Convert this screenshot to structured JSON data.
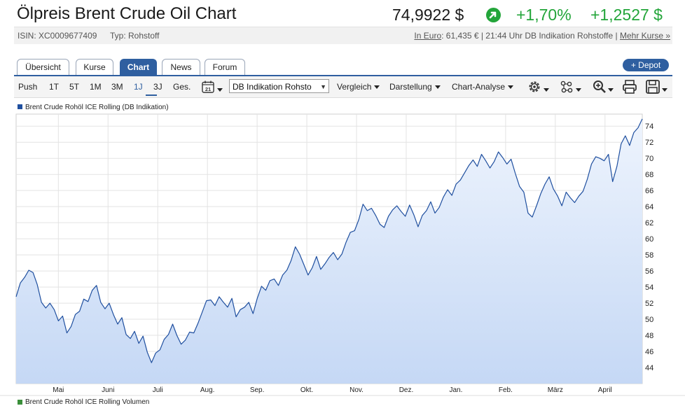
{
  "header": {
    "title": "Ölpreis Brent Crude Oil Chart",
    "price": "74,9922 $",
    "change_pct": "+1,70%",
    "change_abs": "+1,2527 $",
    "positive_color": "#23a53a",
    "trend_icon": "arrow-up-right-icon"
  },
  "subbar": {
    "isin": "ISIN: XC0009677409",
    "type": "Typ: Rohstoff",
    "in_euro_link": "In Euro",
    "euro_info": ": 61,435 € | 21:44 Uhr DB Indikation Rohstoffe | ",
    "more_link": "Mehr Kurse »"
  },
  "tabs": [
    {
      "label": "Übersicht",
      "active": false
    },
    {
      "label": "Kurse",
      "active": false
    },
    {
      "label": "Chart",
      "active": true
    },
    {
      "label": "News",
      "active": false
    },
    {
      "label": "Forum",
      "active": false
    }
  ],
  "depot_button": "+ Depot",
  "toolbar": {
    "periods": [
      "Push",
      "1T",
      "5T",
      "1M",
      "3M",
      "1J",
      "3J",
      "Ges."
    ],
    "active_period": "1J",
    "calendar_icon_day": "21",
    "source_select": "DB Indikation Rohsto",
    "menus": [
      "Vergleich",
      "Darstellung",
      "Chart-Analyse"
    ],
    "icons": [
      "gear-icon",
      "network-icon",
      "zoom-in-icon",
      "print-icon",
      "save-icon"
    ]
  },
  "chart_legend": "Brent Crude Rohöl ICE Rolling (DB Indikation)",
  "volume_legend": "Brent Crude Rohöl ICE Rolling Volumen",
  "accent_color": "#2f5fa0",
  "chart_data": {
    "type": "area",
    "title": "",
    "xlabel": "",
    "ylabel": "",
    "ylim": [
      42,
      75.5
    ],
    "y_ticks": [
      44,
      46,
      48,
      50,
      52,
      54,
      56,
      58,
      60,
      62,
      64,
      66,
      68,
      70,
      72,
      74
    ],
    "y_tick_labels": [
      "44",
      "46",
      "48",
      "50",
      "52",
      "54",
      "56",
      "58",
      "60",
      "62",
      "64",
      "66",
      "68",
      "70",
      "72",
      "74"
    ],
    "x_tick_labels": [
      "Mai",
      "Juni",
      "Juli",
      "Aug.",
      "Sep.",
      "Okt.",
      "Nov.",
      "Dez.",
      "Jan.",
      "Feb.",
      "März",
      "April"
    ],
    "grid": true,
    "line_color": "#1f4f9f",
    "fill_color": "#c5d8f5",
    "series": [
      {
        "name": "Brent Crude Rohöl ICE Rolling (DB Indikation)",
        "values": [
          52.8,
          54.5,
          55.2,
          56.1,
          55.8,
          54.3,
          52.1,
          51.4,
          52.0,
          51.2,
          49.8,
          50.4,
          48.3,
          49.1,
          50.6,
          51.0,
          52.5,
          52.2,
          53.6,
          54.2,
          52.1,
          51.3,
          52.0,
          50.6,
          49.4,
          50.2,
          48.1,
          47.6,
          48.5,
          47.0,
          47.9,
          45.9,
          44.6,
          45.8,
          46.2,
          47.5,
          48.1,
          49.4,
          48.0,
          46.9,
          47.4,
          48.4,
          48.3,
          49.5,
          50.9,
          52.3,
          52.4,
          51.7,
          52.8,
          52.1,
          51.5,
          52.6,
          50.3,
          51.2,
          51.5,
          52.1,
          50.7,
          52.6,
          54.1,
          53.6,
          54.8,
          55.0,
          54.2,
          55.5,
          56.1,
          57.3,
          59.0,
          58.1,
          56.8,
          55.5,
          56.4,
          57.8,
          56.2,
          56.9,
          57.7,
          58.3,
          57.4,
          58.1,
          59.6,
          60.8,
          61.0,
          62.4,
          64.3,
          63.5,
          63.8,
          62.9,
          61.8,
          61.4,
          62.8,
          63.6,
          64.1,
          63.4,
          62.8,
          64.2,
          63.0,
          61.5,
          62.9,
          63.5,
          64.6,
          63.2,
          63.9,
          65.2,
          66.1,
          65.4,
          66.8,
          67.3,
          68.2,
          69.1,
          69.8,
          69.0,
          70.5,
          69.7,
          68.8,
          69.6,
          70.8,
          70.1,
          69.3,
          69.9,
          68.1,
          66.5,
          65.8,
          63.2,
          62.7,
          64.1,
          65.6,
          66.8,
          67.7,
          66.2,
          65.3,
          64.1,
          65.8,
          65.1,
          64.5,
          65.3,
          65.9,
          67.4,
          69.3,
          70.2,
          70.0,
          69.7,
          70.5,
          67.1,
          69.0,
          71.8,
          72.8,
          71.6,
          73.2,
          73.8,
          74.9
        ]
      }
    ]
  }
}
